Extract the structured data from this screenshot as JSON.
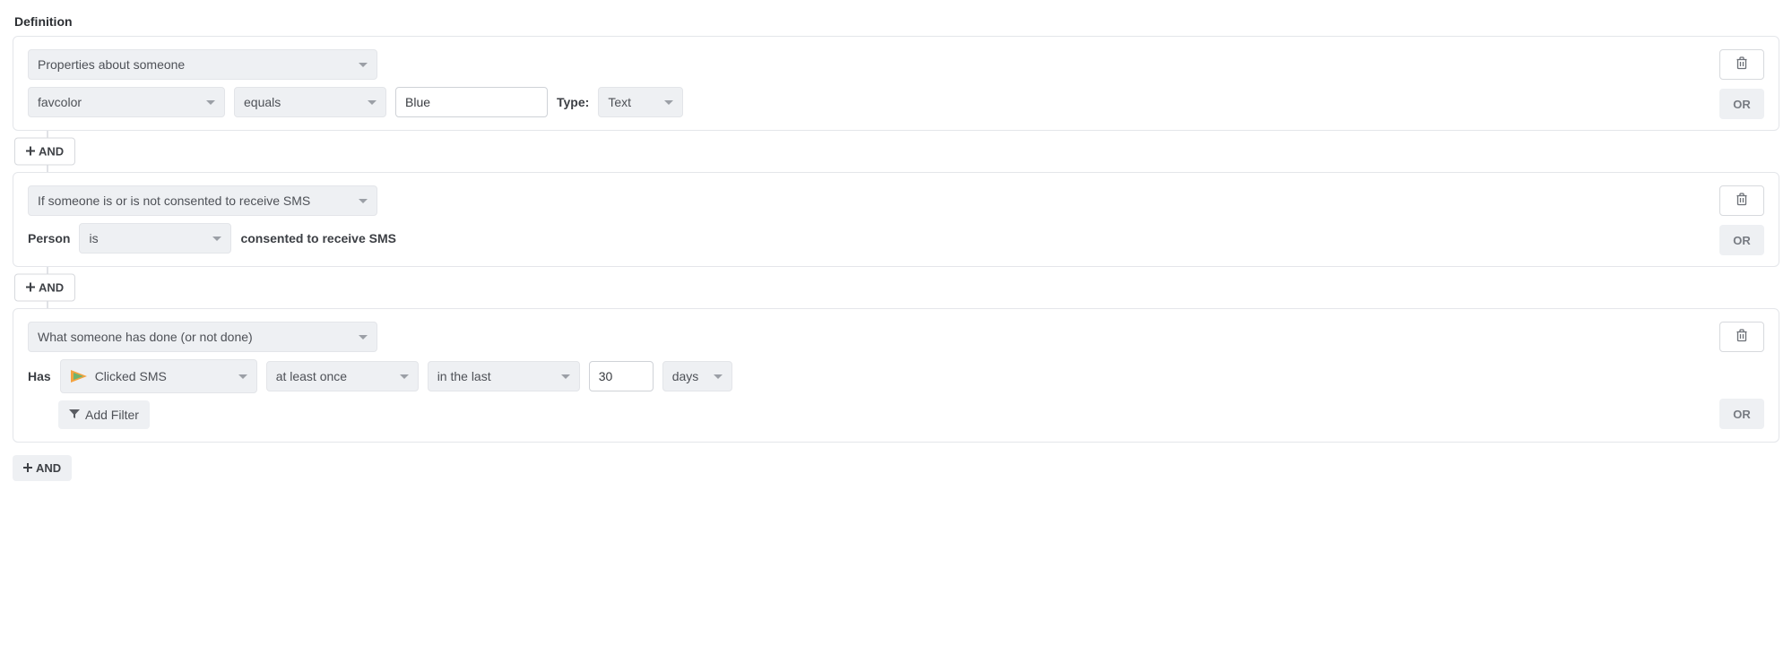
{
  "header": {
    "title": "Definition"
  },
  "labels": {
    "type": "Type:",
    "person": "Person",
    "has": "Has",
    "and": "AND",
    "or": "OR",
    "add_filter": "Add Filter",
    "consent_suffix": "consented to receive SMS"
  },
  "conditions": [
    {
      "type_select": "Properties about someone",
      "property": "favcolor",
      "operator": "equals",
      "value": "Blue",
      "value_type": "Text"
    },
    {
      "type_select": "If someone is or is not consented to receive SMS",
      "person_op": "is"
    },
    {
      "type_select": "What someone has done (or not done)",
      "metric": "Clicked SMS",
      "frequency": "at least once",
      "timeframe_mode": "in the last",
      "timeframe_value": "30",
      "timeframe_unit": "days"
    }
  ]
}
